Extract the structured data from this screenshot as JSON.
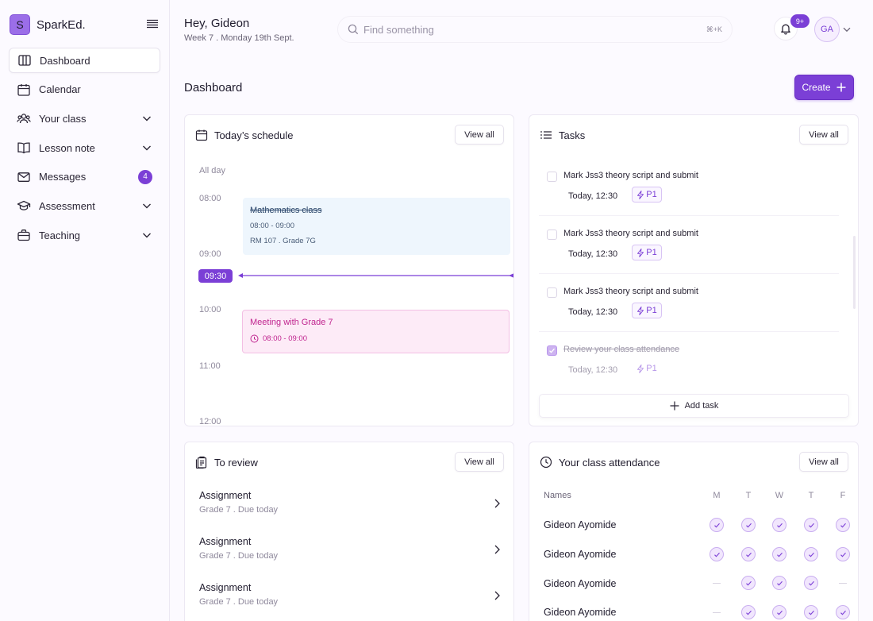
{
  "brand": {
    "logo_letter": "S",
    "name": "SparkEd."
  },
  "sidebar": {
    "items": [
      {
        "label": "Dashboard",
        "icon": "columns-icon",
        "active": true
      },
      {
        "label": "Calendar",
        "icon": "calendar-icon"
      },
      {
        "label": "Your class",
        "icon": "users-icon",
        "expandable": true
      },
      {
        "label": "Lesson note",
        "icon": "book-icon",
        "expandable": true
      },
      {
        "label": "Messages",
        "icon": "mail-icon",
        "badge": "4"
      },
      {
        "label": "Assessment",
        "icon": "graduation-cap-icon",
        "expandable": true
      },
      {
        "label": "Teaching",
        "icon": "briefcase-icon",
        "expandable": true
      }
    ]
  },
  "header": {
    "greeting": "Hey, Gideon",
    "subtitle": "Week 7 . Monday 19th Sept.",
    "search_placeholder": "Find something",
    "search_shortcut": "⌘+K",
    "notification_badge": "9+",
    "avatar_initials": "GA"
  },
  "page": {
    "title": "Dashboard",
    "create_label": "Create"
  },
  "schedule": {
    "title": "Today’s schedule",
    "view_all": "View all",
    "all_day": "All day",
    "times": [
      "08:00",
      "09:00",
      "10:00",
      "11:00",
      "12:00"
    ],
    "current_time": "09:30",
    "events": [
      {
        "title": "Mathematics class",
        "time": "08:00 - 09:00",
        "location": "RM 107 . Grade 7G",
        "completed": true
      },
      {
        "title": "Meeting with Grade 7",
        "time": "08:00 - 09:00"
      }
    ]
  },
  "tasks": {
    "title": "Tasks",
    "view_all": "View all",
    "items": [
      {
        "title": "Mark Jss3 theory script and submit",
        "time": "Today, 12:30",
        "priority": "P1",
        "done": false
      },
      {
        "title": "Mark Jss3 theory script and submit",
        "time": "Today, 12:30",
        "priority": "P1",
        "done": false
      },
      {
        "title": "Mark Jss3 theory script and submit",
        "time": "Today, 12:30",
        "priority": "P1",
        "done": false
      },
      {
        "title": "Review your class attendance",
        "time": "Today, 12:30",
        "priority": "P1",
        "done": true
      }
    ],
    "add_label": "Add task"
  },
  "review": {
    "title": "To review",
    "view_all": "View all",
    "items": [
      {
        "title": "Assignment",
        "subtitle": "Grade 7 . Due today"
      },
      {
        "title": "Assignment",
        "subtitle": "Grade 7 . Due today"
      },
      {
        "title": "Assignment",
        "subtitle": "Grade 7 . Due today"
      }
    ]
  },
  "attendance": {
    "title": "Your class attendance",
    "view_all": "View all",
    "names_header": "Names",
    "days": [
      "M",
      "T",
      "W",
      "T",
      "F"
    ],
    "rows": [
      {
        "name": "Gideon Ayomide",
        "present": [
          true,
          true,
          true,
          true,
          true
        ]
      },
      {
        "name": "Gideon Ayomide",
        "present": [
          true,
          true,
          true,
          true,
          true
        ]
      },
      {
        "name": "Gideon Ayomide",
        "present": [
          false,
          true,
          true,
          true,
          false
        ]
      },
      {
        "name": "Gideon Ayomide",
        "present": [
          false,
          true,
          true,
          true,
          true
        ]
      }
    ]
  },
  "colors": {
    "accent": "#7b3fd6",
    "event_blue_bg": "#eef6fd",
    "event_pink_bg": "#fdebf7",
    "event_pink_text": "#c0258f"
  }
}
